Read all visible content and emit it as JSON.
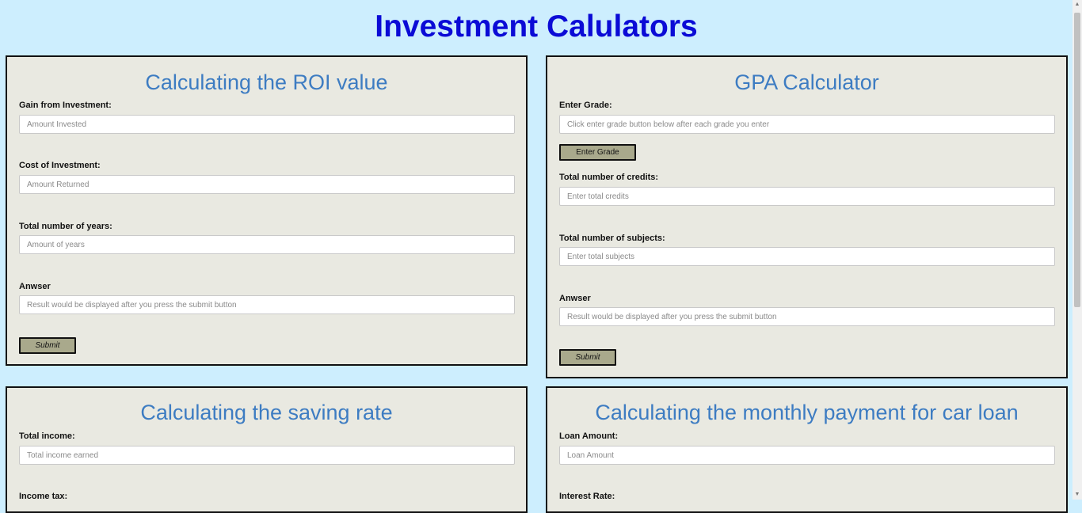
{
  "page": {
    "title": "Investment Calulators"
  },
  "roi": {
    "title": "Calculating the ROI value",
    "gain_label": "Gain from Investment:",
    "gain_placeholder": "Amount Invested",
    "cost_label": "Cost of Investment:",
    "cost_placeholder": "Amount Returned",
    "years_label": "Total number of years:",
    "years_placeholder": "Amount of years",
    "answer_label": "Anwser",
    "answer_placeholder": "Result would be displayed after you press the submit button",
    "submit_label": "Submit"
  },
  "gpa": {
    "title": "GPA Calculator",
    "grade_label": "Enter Grade:",
    "grade_placeholder": "Click enter grade button below after each grade you enter",
    "enter_grade_label": "Enter Grade",
    "credits_label": "Total number of credits:",
    "credits_placeholder": "Enter total credits",
    "subjects_label": "Total number of subjects:",
    "subjects_placeholder": "Enter total subjects",
    "answer_label": "Anwser",
    "answer_placeholder": "Result would be displayed after you press the submit button",
    "submit_label": "Submit"
  },
  "saving": {
    "title": "Calculating the saving rate",
    "income_label": "Total income:",
    "income_placeholder": "Total income earned",
    "tax_label": "Income tax:"
  },
  "car_loan": {
    "title": "Calculating the monthly payment for car loan",
    "loan_label": "Loan Amount:",
    "loan_placeholder": "Loan Amount",
    "rate_label": "Interest Rate:"
  },
  "colors": {
    "background": "#cdeefe",
    "title": "#0b0bd6",
    "panel": "#e9e9e1",
    "panel_heading": "#3d7cc2",
    "button": "#a9a98c"
  }
}
